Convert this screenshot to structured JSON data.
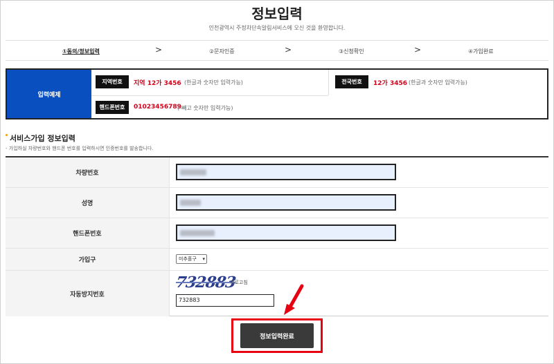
{
  "page": {
    "title": "정보입력",
    "subtitle": "인천광역시 주정차단속알림서비스에 오신 것을 환영합니다."
  },
  "steps": [
    {
      "label": "①동의/정보입력",
      "active": true
    },
    {
      "label": "②문자인증",
      "active": false
    },
    {
      "label": "③신청확인",
      "active": false
    },
    {
      "label": "④가입완료",
      "active": false
    }
  ],
  "step_separator": ">",
  "example": {
    "label": "입력예제",
    "regional": {
      "tag": "지역번호",
      "value": "지역 12가 3456",
      "note": "(한글과 숫자만 입력가능)"
    },
    "national": {
      "tag": "전국번호",
      "value": "12가 3456",
      "note": "(한글과 숫자만 입력가능)"
    },
    "phone": {
      "tag": "핸드폰번호",
      "value": "01023456789",
      "note": "(-빼고 숫자만 입력가능)"
    }
  },
  "section": {
    "title": "서비스가입 정보입력",
    "desc": "- 가입하실 차량번호와 핸드폰 번호를 입력하시면 인증번호를 발송합니다."
  },
  "form": {
    "vehicle_label": "차량번호",
    "name_label": "성명",
    "phone_label": "핸드폰번호",
    "district_label": "가입구",
    "district_value": "미추홀구",
    "captcha_label": "자동방지번호",
    "captcha_image_text": "732883",
    "refresh_label": "새로고침",
    "captcha_value": "732883"
  },
  "submit_label": "정보입력완료",
  "colors": {
    "accent_blue": "#0a4fbf",
    "highlight_red": "#e60012",
    "value_red": "#d0021b",
    "button_dark": "#3a3a3a"
  },
  "icons": {
    "step_arrow": "chevron-right-icon",
    "pointer": "red-arrow-icon"
  }
}
